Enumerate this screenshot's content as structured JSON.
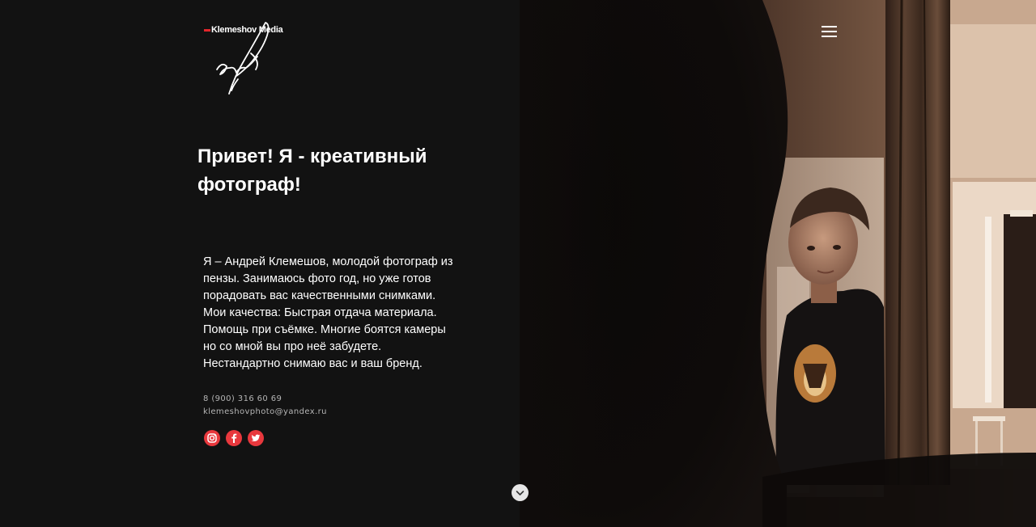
{
  "brand": {
    "logo_text": "Klemeshov Media",
    "accent_color": "#e3262b"
  },
  "header": {
    "menu_icon": "hamburger-menu-icon"
  },
  "hero": {
    "title": "Привет! Я - креативный фотограф!",
    "description": "Я – Андрей Клемешов, молодой фотограф из пензы. Занимаюсь фото год, но уже готов порадовать вас качественными снимками. Мои качества: Быстрая отдача материала. Помощь при съёмке. Многие боятся камеры но со мной вы про неё забудете. Нестандартно снимаю вас и ваш бренд."
  },
  "contacts": {
    "phone": "8 (900) 316 60 69",
    "email": "klemeshovphoto@yandex.ru"
  },
  "socials": [
    {
      "name": "instagram",
      "icon": "instagram-icon",
      "color": "#e8383d"
    },
    {
      "name": "facebook",
      "icon": "facebook-icon",
      "color": "#e8383d"
    },
    {
      "name": "twitter",
      "icon": "twitter-icon",
      "color": "#e8383d"
    }
  ],
  "scroll": {
    "icon": "chevron-down-icon"
  }
}
